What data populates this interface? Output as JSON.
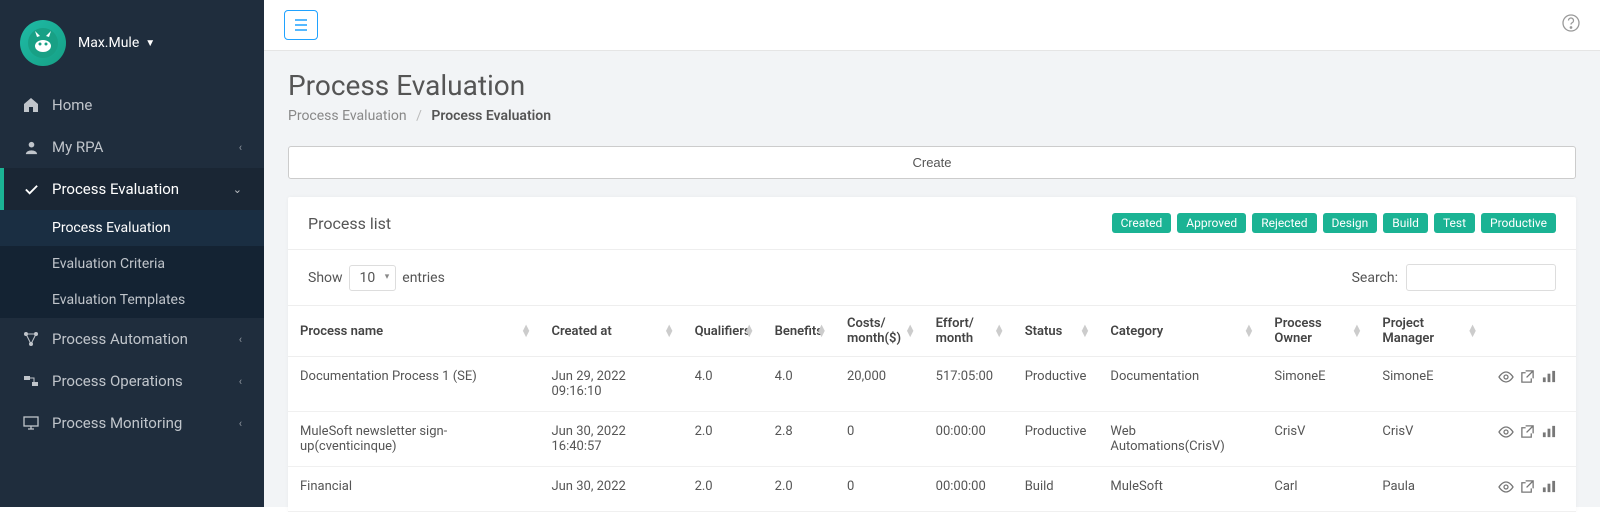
{
  "user": {
    "name": "Max.Mule"
  },
  "nav": {
    "home": "Home",
    "myrpa": "My RPA",
    "proc_eval": "Process Evaluation",
    "proc_eval_sub1": "Process Evaluation",
    "proc_eval_sub2": "Evaluation Criteria",
    "proc_eval_sub3": "Evaluation Templates",
    "proc_auto": "Process Automation",
    "proc_ops": "Process Operations",
    "proc_mon": "Process Monitoring"
  },
  "page": {
    "title": "Process Evaluation",
    "breadcrumb_root": "Process Evaluation",
    "breadcrumb_current": "Process Evaluation",
    "create_label": "Create"
  },
  "panel": {
    "title": "Process list",
    "badges": [
      "Created",
      "Approved",
      "Rejected",
      "Design",
      "Build",
      "Test",
      "Productive"
    ]
  },
  "table": {
    "show_label": "Show",
    "entries_label": "entries",
    "entries_value": "10",
    "search_label": "Search:",
    "headers": {
      "name": "Process name",
      "created": "Created at",
      "qualifiers": "Qualifiers",
      "benefits": "Benefits",
      "costs": "Costs/ month($)",
      "effort": "Effort/ month",
      "status": "Status",
      "category": "Category",
      "owner": "Process Owner",
      "pm": "Project Manager"
    },
    "rows": [
      {
        "name": "Documentation Process 1 (SE)",
        "created": "Jun 29, 2022 09:16:10",
        "qualifiers": "4.0",
        "benefits": "4.0",
        "costs": "20,000",
        "effort": "517:05:00",
        "status": "Productive",
        "category": "Documentation",
        "owner": "SimoneE",
        "pm": "SimoneE"
      },
      {
        "name": "MuleSoft newsletter sign-up(cventicinque)",
        "created": "Jun 30, 2022 16:40:57",
        "qualifiers": "2.0",
        "benefits": "2.8",
        "costs": "0",
        "effort": "00:00:00",
        "status": "Productive",
        "category": "Web Automations(CrisV)",
        "owner": "CrisV",
        "pm": "CrisV"
      },
      {
        "name": "Financial",
        "created": "Jun 30, 2022",
        "qualifiers": "2.0",
        "benefits": "2.0",
        "costs": "0",
        "effort": "00:00:00",
        "status": "Build",
        "category": "MuleSoft",
        "owner": "Carl",
        "pm": "Paula"
      }
    ]
  }
}
